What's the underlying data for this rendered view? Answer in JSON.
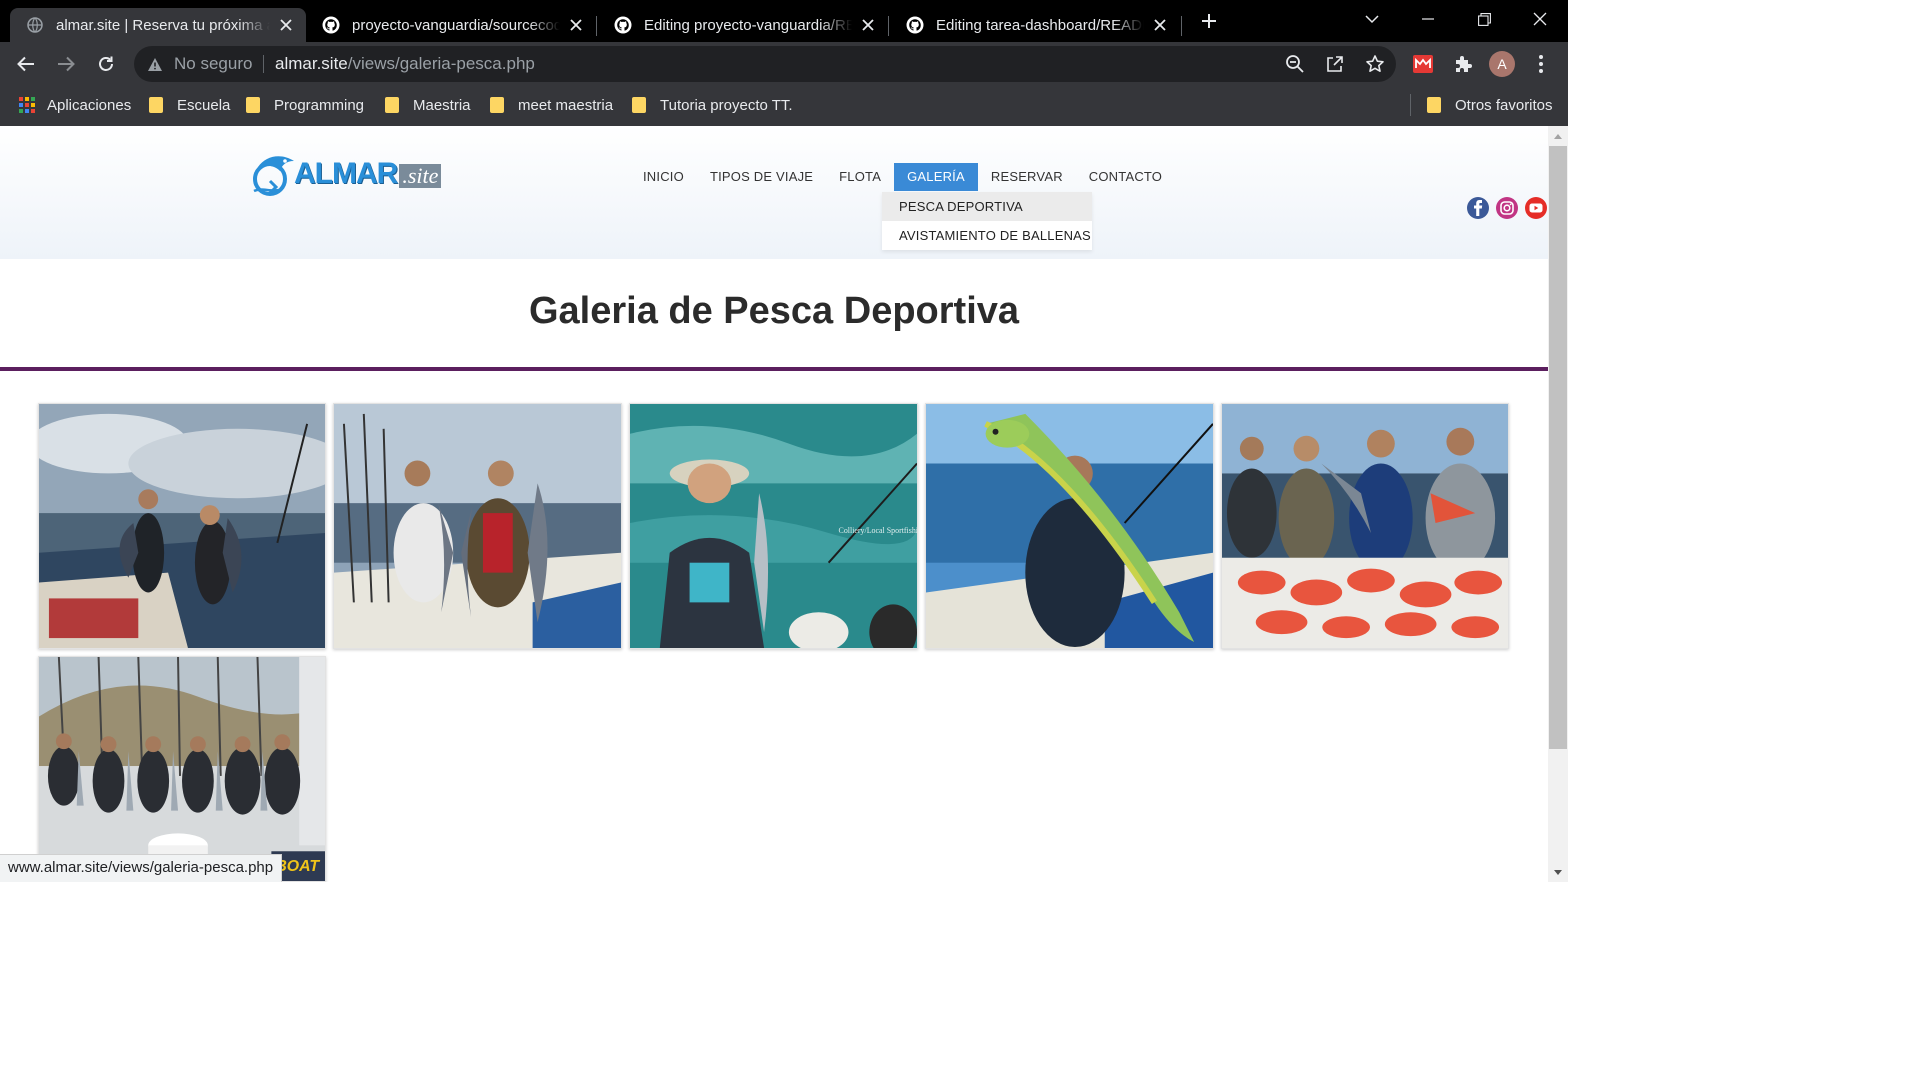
{
  "browser": {
    "tabs": [
      {
        "title": "almar.site | Reserva tu próxima aventura",
        "active": true,
        "favicon": "globe-icon"
      },
      {
        "title": "proyecto-vanguardia/sourcecode",
        "active": false,
        "favicon": "github-icon"
      },
      {
        "title": "Editing proyecto-vanguardia/README",
        "active": false,
        "favicon": "github-icon"
      },
      {
        "title": "Editing tarea-dashboard/README",
        "active": false,
        "favicon": "github-icon"
      }
    ],
    "omnibox": {
      "security_label": "No seguro",
      "host": "almar.site",
      "path": "/views/galeria-pesca.php"
    },
    "avatar_initial": "A",
    "bookmarks": [
      {
        "label": "Aplicaciones",
        "icon": "apps-icon"
      },
      {
        "label": "Escuela",
        "icon": "folder-icon"
      },
      {
        "label": "Programming",
        "icon": "folder-icon"
      },
      {
        "label": "Maestria",
        "icon": "folder-icon"
      },
      {
        "label": "meet maestria",
        "icon": "folder-icon"
      },
      {
        "label": "Tutoria proyecto TT.",
        "icon": "folder-icon"
      }
    ],
    "other_bookmarks": "Otros favoritos",
    "status_url": "www.almar.site/views/galeria-pesca.php"
  },
  "site": {
    "logo": {
      "main": "ALMAR",
      "sub": ".site"
    },
    "nav": [
      "INICIO",
      "TIPOS DE VIAJE",
      "FLOTA",
      "GALERÍA",
      "RESERVAR",
      "CONTACTO"
    ],
    "active_nav": "GALERÍA",
    "dropdown": [
      "PESCA DEPORTIVA",
      "AVISTAMIENTO DE BALLENAS"
    ],
    "social": [
      "facebook-icon",
      "instagram-icon",
      "youtube-icon"
    ],
    "page_title": "Galeria de Pesca Deportiva",
    "photo_caption": "Colliery/Local Sportfishing",
    "boat_lettering": "BOAT"
  },
  "colors": {
    "nav_active": "#3a8ad6",
    "title_rule": "#5b1f5e",
    "brand_blue": "#2a8fd8"
  }
}
